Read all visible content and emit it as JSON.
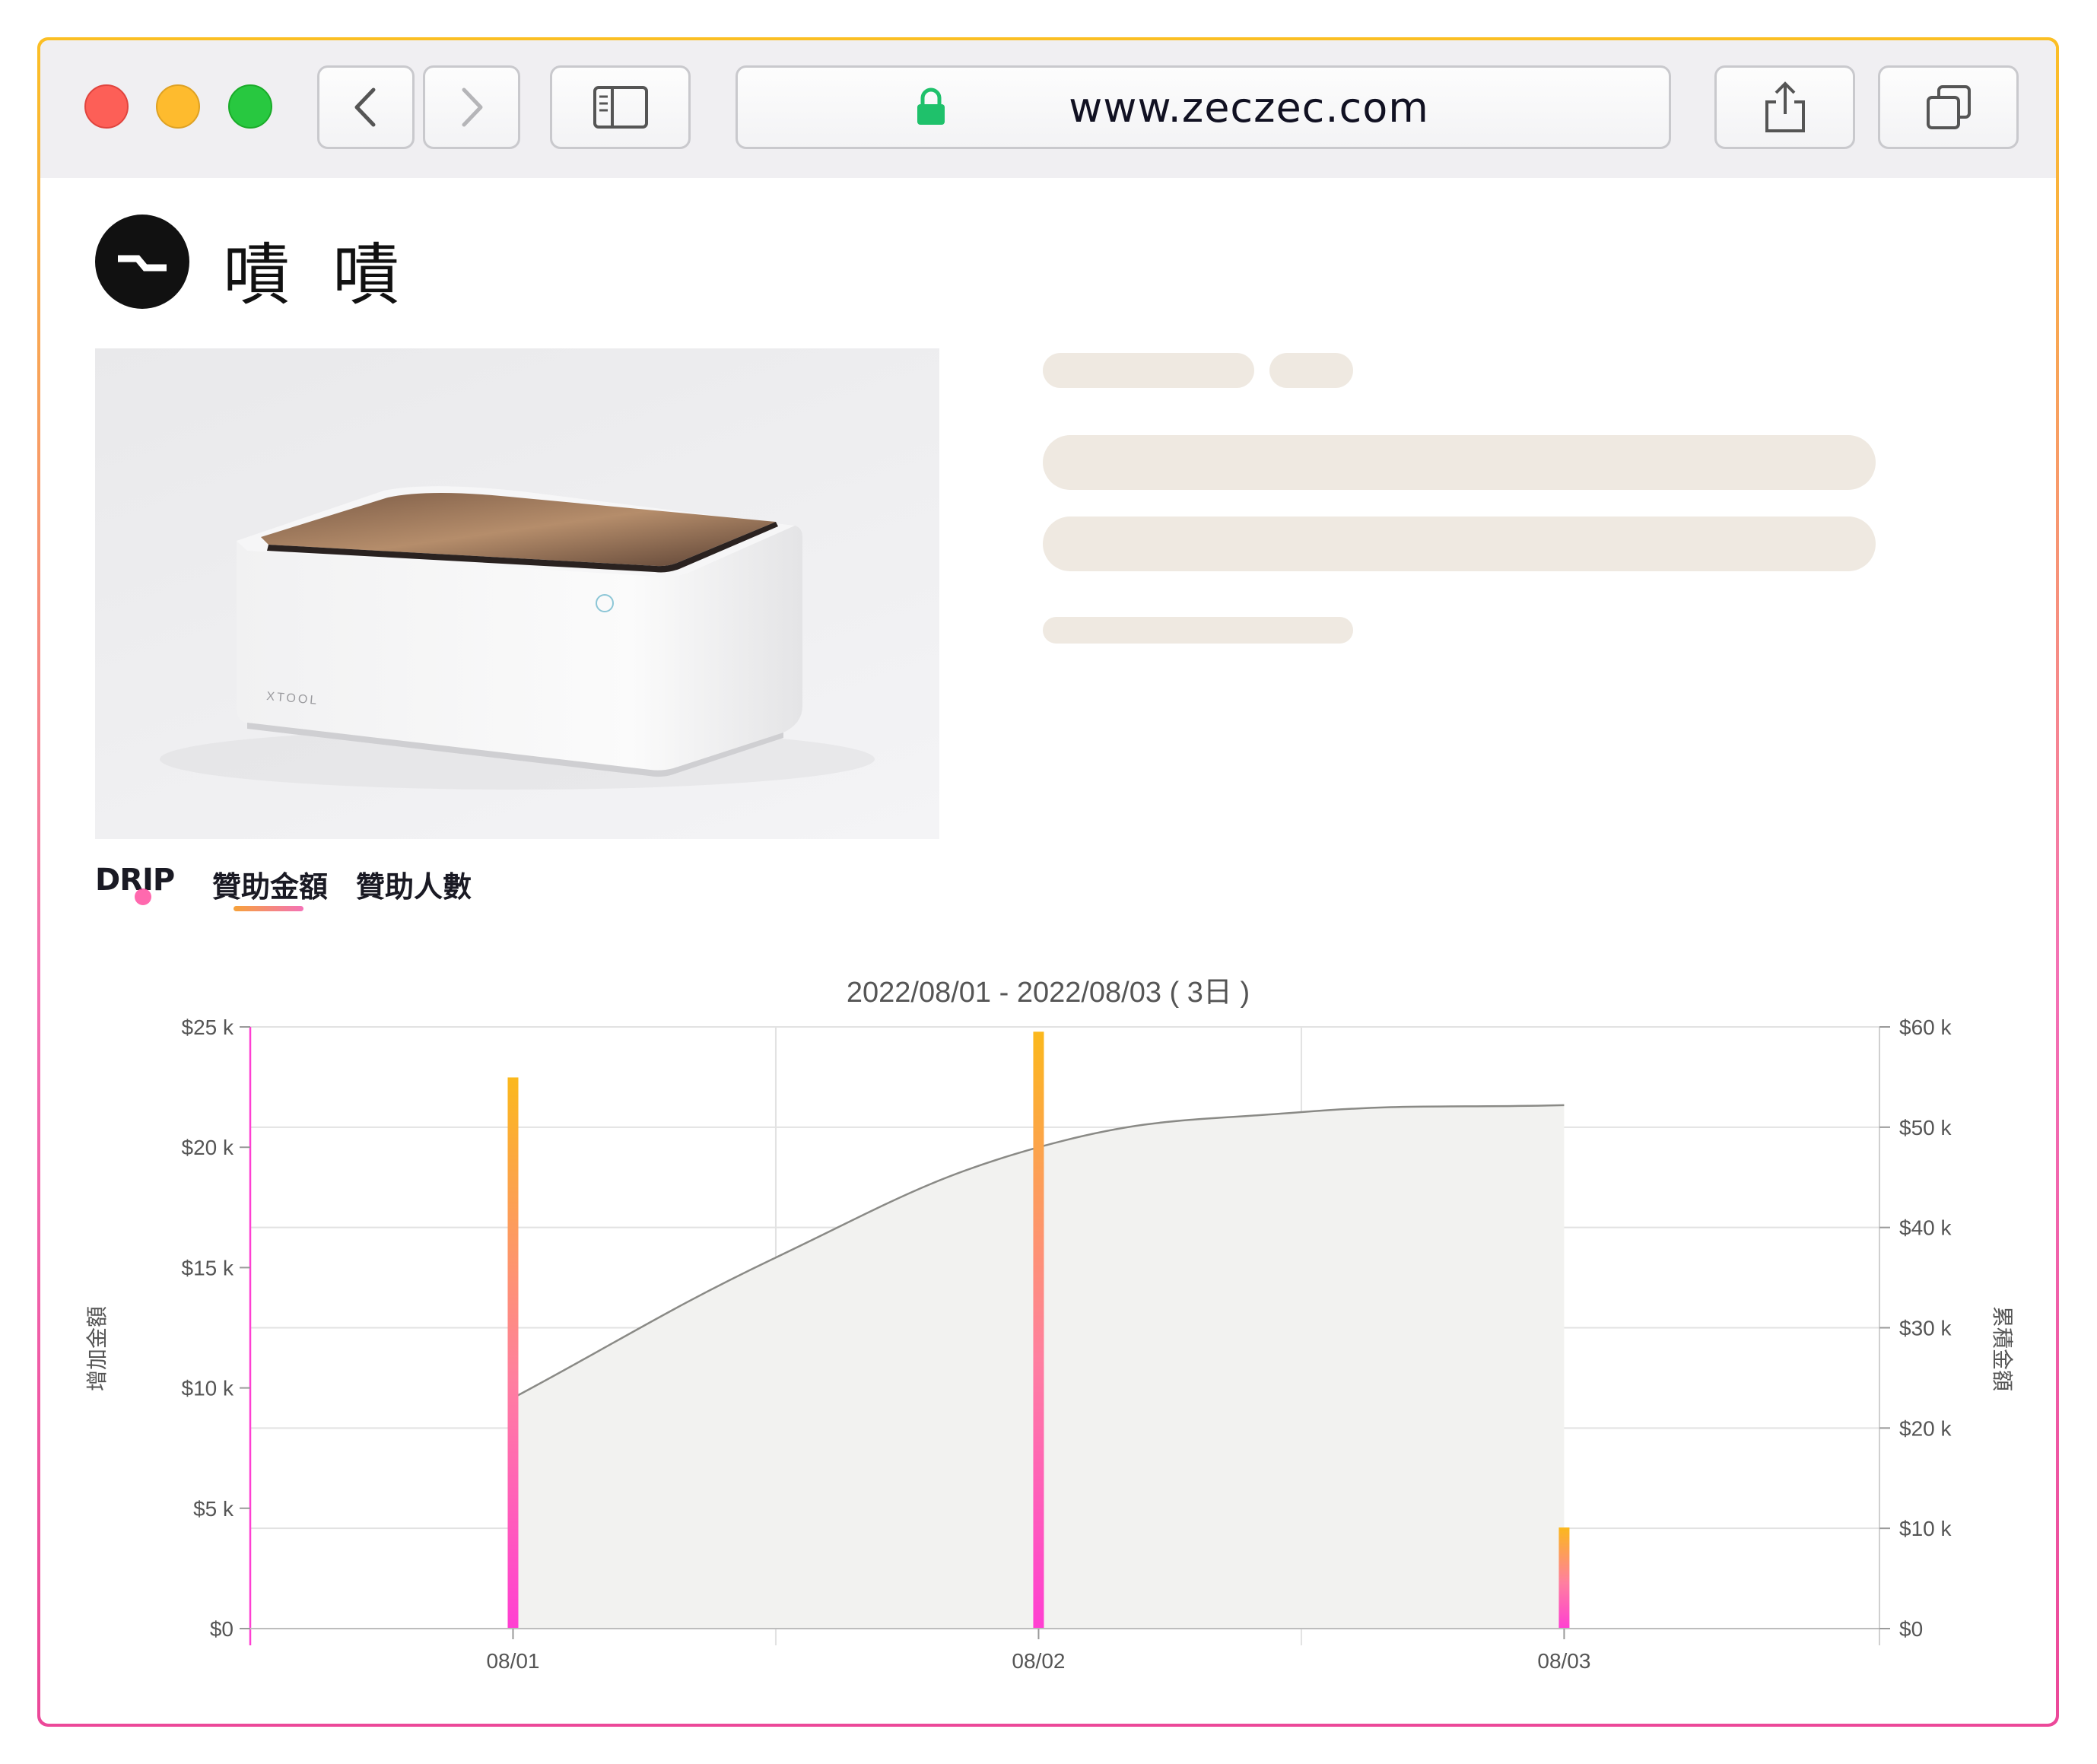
{
  "browser": {
    "url": "www.zeczec.com",
    "lock_icon": "lock-icon",
    "buttons": [
      "back-icon",
      "forward-icon",
      "sidebar-icon",
      "share-icon",
      "tabs-icon"
    ]
  },
  "brand": {
    "name": "嘖 嘖",
    "logo_icon": "zeczec-logo-icon"
  },
  "product": {
    "image_label": "XTOOL"
  },
  "tabs": {
    "logo": "DRIP",
    "items": [
      "贊助金額",
      "贊助人數"
    ],
    "active_index": 0
  },
  "colors": {
    "accent_start": "#fbbf24",
    "accent_end": "#ff3fd2",
    "placeholder": "#efe9e1",
    "area_fill": "#f2f2f0",
    "line": "#888888"
  },
  "chart_data": {
    "type": "bar",
    "title": "2022/08/01 - 2022/08/03 ( 3日 )",
    "categories": [
      "08/01",
      "08/02",
      "08/03"
    ],
    "series": [
      {
        "name": "增加金額",
        "axis": "left",
        "type": "bar",
        "values": [
          22900,
          24800,
          4200
        ]
      },
      {
        "name": "累積金額",
        "axis": "right",
        "type": "area",
        "x": [
          0,
          0.5,
          1,
          1.5,
          2
        ],
        "values": [
          23000,
          37000,
          48000,
          51500,
          52200
        ]
      }
    ],
    "ylabel": "增加金額",
    "y2label": "累積金額",
    "ylim": [
      0,
      25000
    ],
    "y2lim": [
      0,
      60000
    ],
    "yticks": [
      "$0",
      "$5 k",
      "$10 k",
      "$15 k",
      "$20 k",
      "$25 k"
    ],
    "y2ticks": [
      "$0",
      "$10 k",
      "$20 k",
      "$30 k",
      "$40 k",
      "$50 k",
      "$60 k"
    ],
    "grid": true
  }
}
